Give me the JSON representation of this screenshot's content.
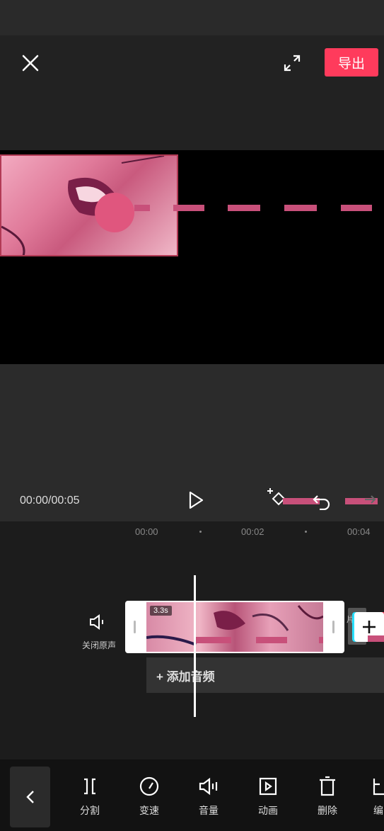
{
  "header": {
    "export_label": "导出"
  },
  "player": {
    "time": "00:00/00:05"
  },
  "ruler": {
    "ticks": [
      "00:00",
      "00:02",
      "00:04"
    ]
  },
  "track": {
    "mute_label": "关闭原声",
    "clip_duration": "3.3s",
    "next_clip_label": "片尾",
    "add_audio_label": "+ 添加音频"
  },
  "toolbar": {
    "items": [
      {
        "label": "分割",
        "icon": "split-icon"
      },
      {
        "label": "变速",
        "icon": "speed-icon"
      },
      {
        "label": "音量",
        "icon": "volume-icon"
      },
      {
        "label": "动画",
        "icon": "animation-icon"
      },
      {
        "label": "删除",
        "icon": "delete-icon"
      },
      {
        "label": "编",
        "icon": "edit-icon"
      }
    ]
  },
  "colors": {
    "accent": "#ff3b5c",
    "dash": "#c8507a"
  }
}
